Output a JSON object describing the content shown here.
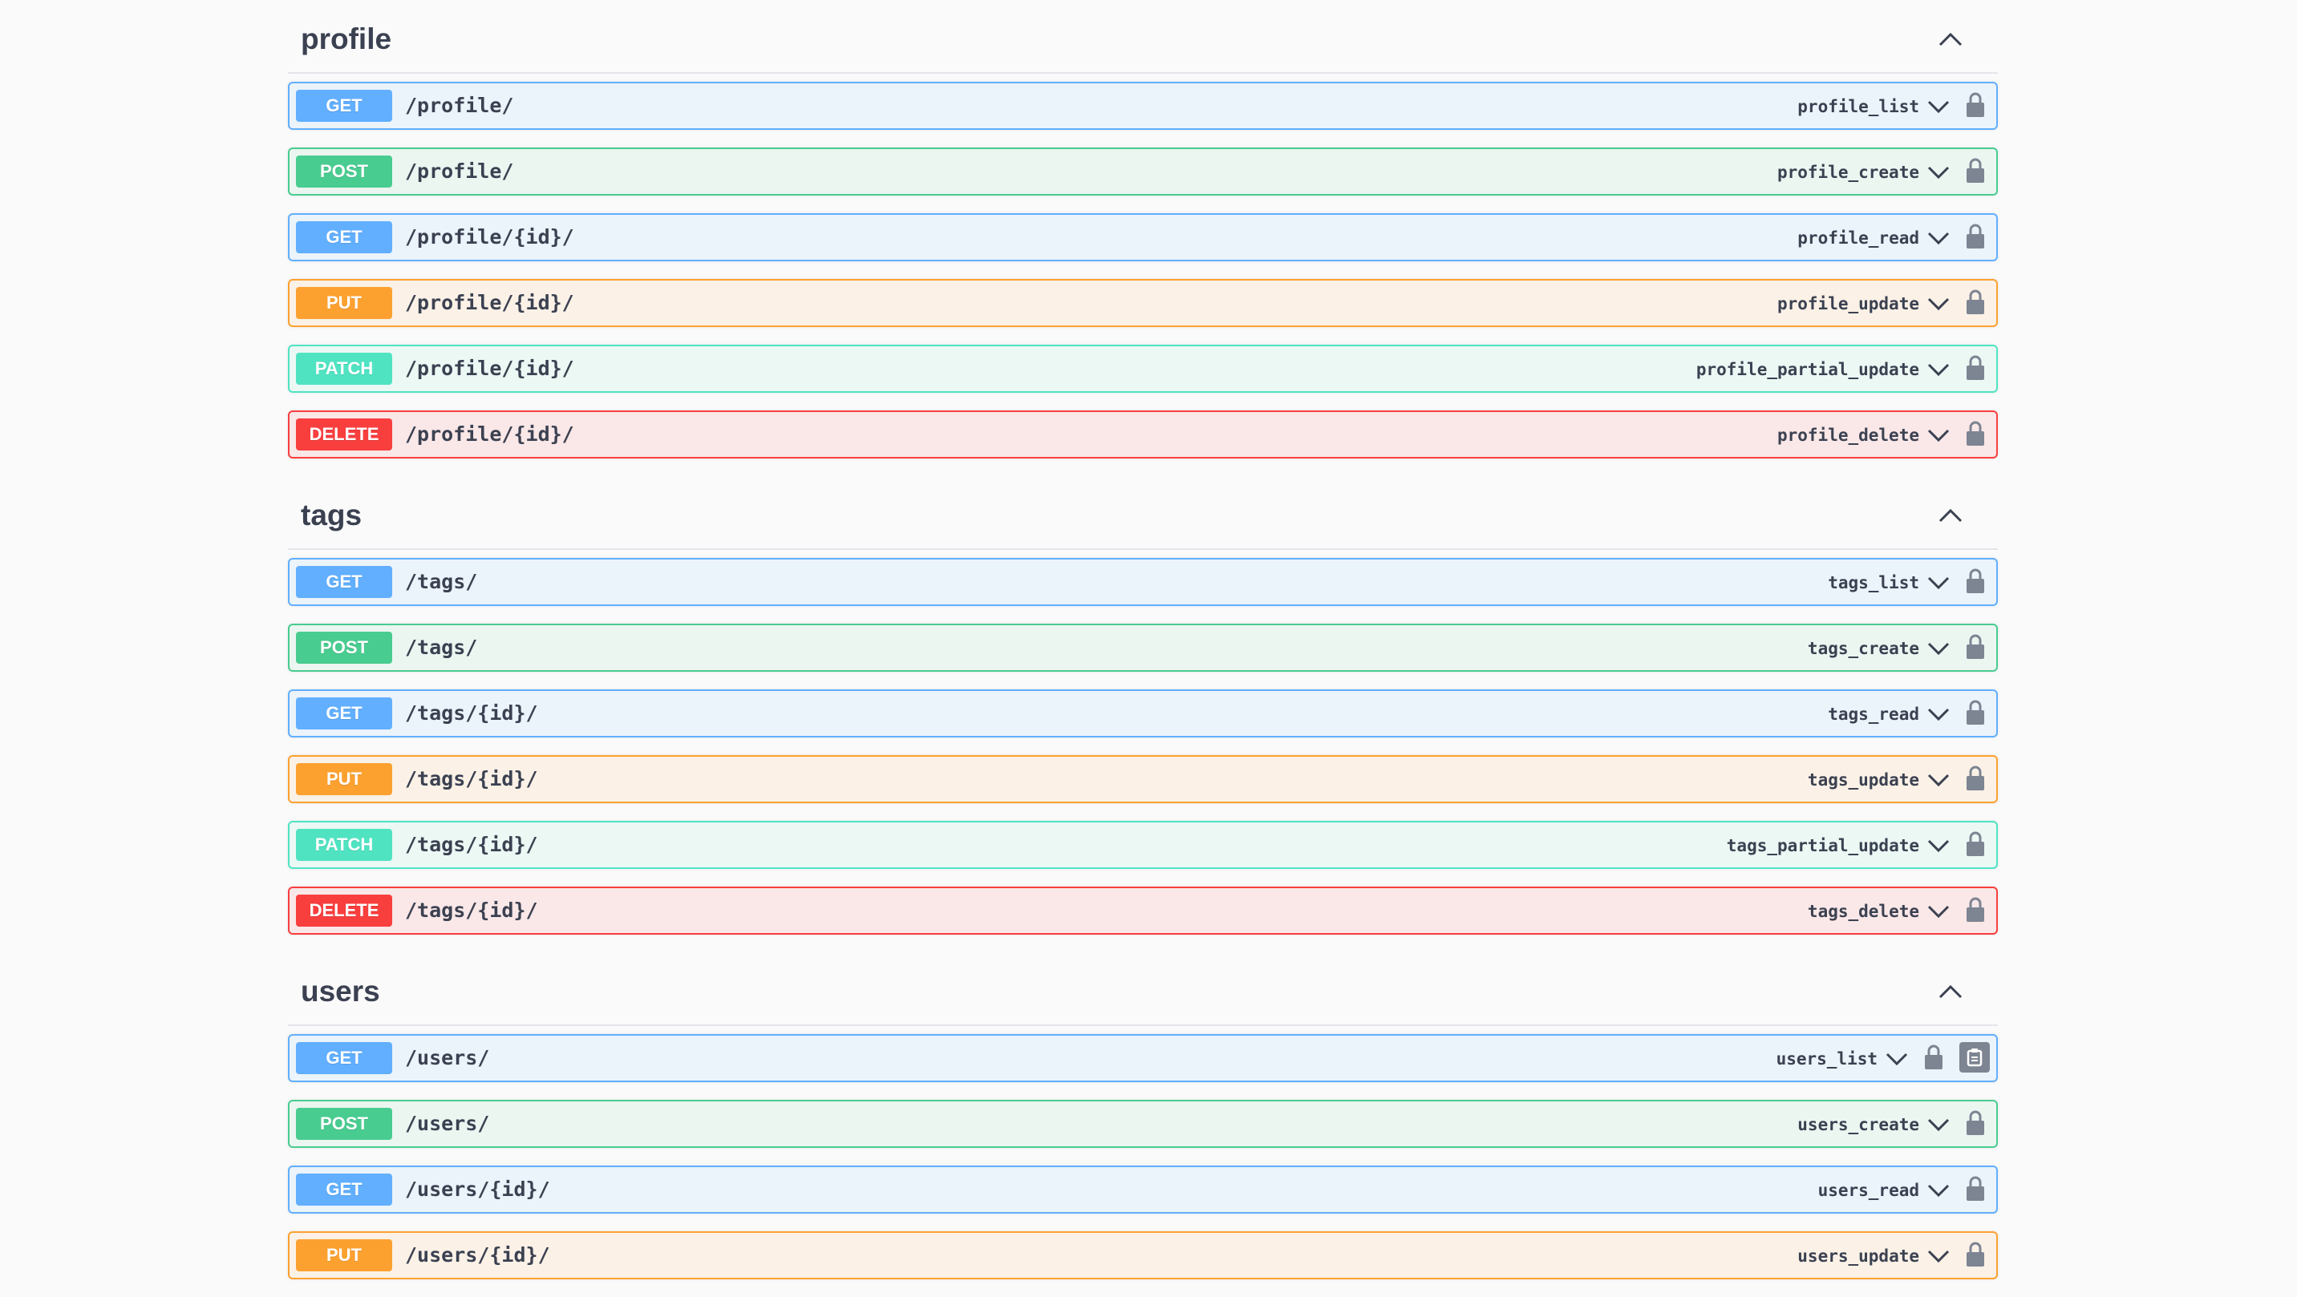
{
  "colors": {
    "get": "#61affe",
    "post": "#49cc90",
    "put": "#fca130",
    "patch": "#50e3c2",
    "delete": "#f93e3e",
    "text": "#3b4151",
    "background": "#fafafa"
  },
  "icons": {
    "tag_toggle": "chevron-up-icon",
    "operation_toggle": "chevron-down-icon",
    "authorization": "lock-icon",
    "copy": "clipboard-icon"
  },
  "sections": [
    {
      "title": "profile",
      "operations": [
        {
          "method": "GET",
          "path": "/profile/",
          "operation_id": "profile_list"
        },
        {
          "method": "POST",
          "path": "/profile/",
          "operation_id": "profile_create"
        },
        {
          "method": "GET",
          "path": "/profile/{id}/",
          "operation_id": "profile_read"
        },
        {
          "method": "PUT",
          "path": "/profile/{id}/",
          "operation_id": "profile_update"
        },
        {
          "method": "PATCH",
          "path": "/profile/{id}/",
          "operation_id": "profile_partial_update"
        },
        {
          "method": "DELETE",
          "path": "/profile/{id}/",
          "operation_id": "profile_delete"
        }
      ]
    },
    {
      "title": "tags",
      "operations": [
        {
          "method": "GET",
          "path": "/tags/",
          "operation_id": "tags_list"
        },
        {
          "method": "POST",
          "path": "/tags/",
          "operation_id": "tags_create"
        },
        {
          "method": "GET",
          "path": "/tags/{id}/",
          "operation_id": "tags_read"
        },
        {
          "method": "PUT",
          "path": "/tags/{id}/",
          "operation_id": "tags_update"
        },
        {
          "method": "PATCH",
          "path": "/tags/{id}/",
          "operation_id": "tags_partial_update"
        },
        {
          "method": "DELETE",
          "path": "/tags/{id}/",
          "operation_id": "tags_delete"
        }
      ]
    },
    {
      "title": "users",
      "operations": [
        {
          "method": "GET",
          "path": "/users/",
          "operation_id": "users_list"
        },
        {
          "method": "POST",
          "path": "/users/",
          "operation_id": "users_create"
        },
        {
          "method": "GET",
          "path": "/users/{id}/",
          "operation_id": "users_read"
        },
        {
          "method": "PUT",
          "path": "/users/{id}/",
          "operation_id": "users_update"
        }
      ]
    }
  ]
}
